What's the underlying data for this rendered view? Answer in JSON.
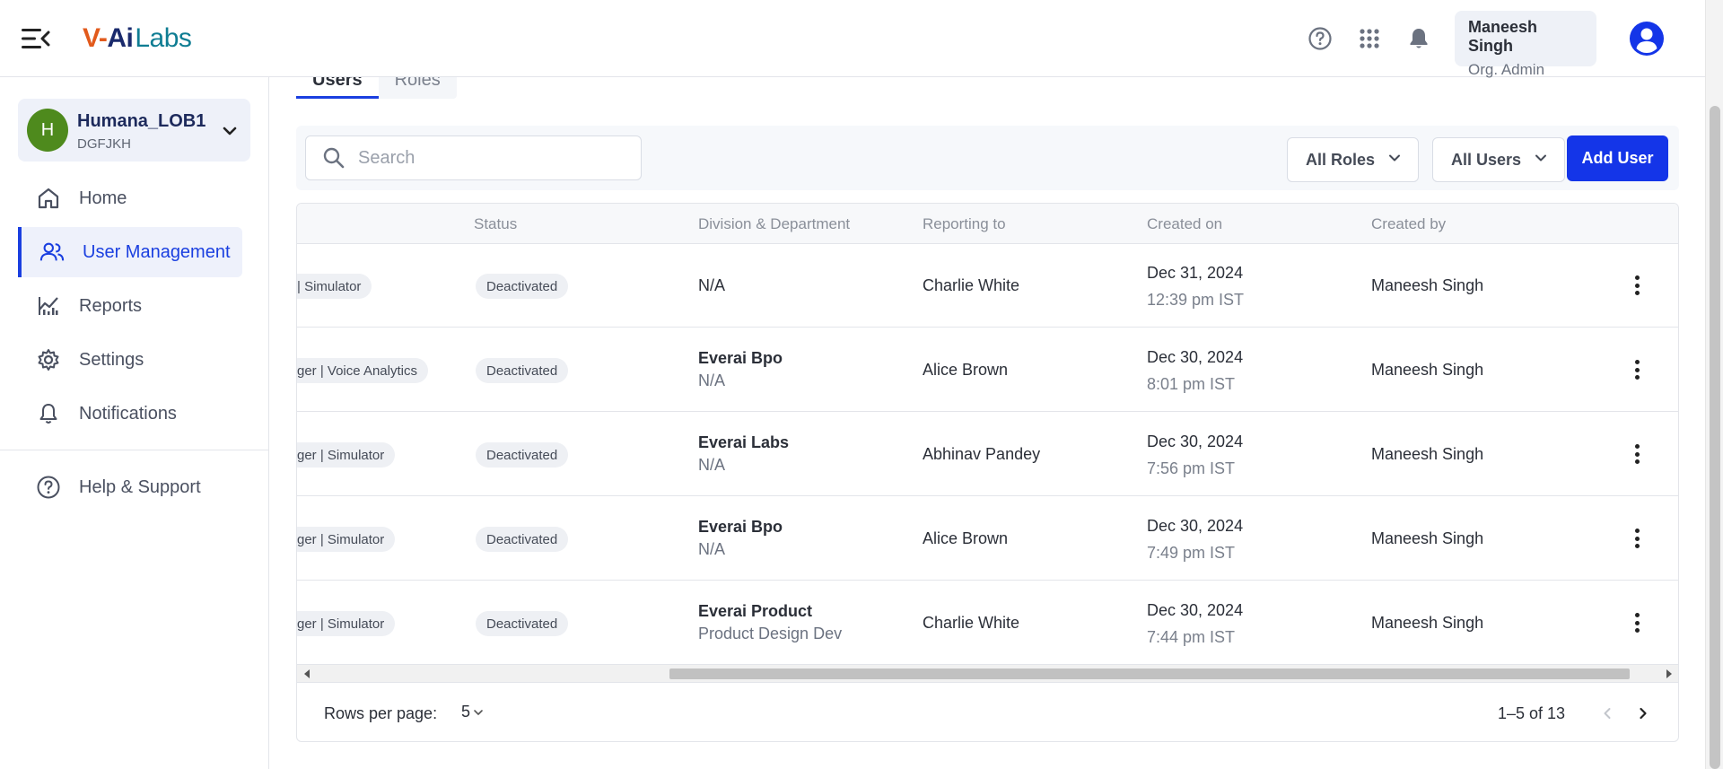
{
  "header": {
    "logo": {
      "part1": "V-",
      "part2": "Ai",
      "part3": "Labs"
    },
    "user_name": "Maneesh Singh",
    "user_role": "Org. Admin",
    "icons": [
      "menu-collapse-icon",
      "help-icon",
      "apps-grid-icon",
      "bell-icon",
      "account-circle-icon"
    ]
  },
  "sidebar": {
    "org": {
      "initial": "H",
      "name": "Humana_LOB1",
      "code": "DGFJKH"
    },
    "items": [
      {
        "label": "Home",
        "icon": "home-icon"
      },
      {
        "label": "User Management",
        "icon": "users-icon"
      },
      {
        "label": "Reports",
        "icon": "reports-icon"
      },
      {
        "label": "Settings",
        "icon": "gear-icon"
      },
      {
        "label": "Notifications",
        "icon": "bell-icon"
      }
    ],
    "help": {
      "label": "Help & Support",
      "icon": "help-icon"
    }
  },
  "tabs": [
    {
      "label": "Users"
    },
    {
      "label": "Roles"
    }
  ],
  "toolbar": {
    "search_placeholder": "Search",
    "search_value": "",
    "roles_filter": "All Roles",
    "users_filter": "All Users",
    "add_label": "Add User"
  },
  "table": {
    "columns": [
      "Status",
      "Division & Department",
      "Reporting to",
      "Created on",
      "Created by"
    ],
    "rows": [
      {
        "role": "| Simulator",
        "status": "Deactivated",
        "division": "",
        "department": "N/A",
        "reporting": "Charlie White",
        "date": "Dec 31, 2024",
        "time": "12:39 pm IST",
        "created_by": "Maneesh Singh"
      },
      {
        "role": "ger | Voice Analytics",
        "status": "Deactivated",
        "division": "Everai Bpo",
        "department": "N/A",
        "reporting": "Alice Brown",
        "date": "Dec 30, 2024",
        "time": "8:01 pm IST",
        "created_by": "Maneesh Singh"
      },
      {
        "role": "ger | Simulator",
        "status": "Deactivated",
        "division": "Everai Labs",
        "department": "N/A",
        "reporting": "Abhinav Pandey",
        "date": "Dec 30, 2024",
        "time": "7:56 pm IST",
        "created_by": "Maneesh Singh"
      },
      {
        "role": "ger | Simulator",
        "status": "Deactivated",
        "division": "Everai Bpo",
        "department": "N/A",
        "reporting": "Alice Brown",
        "date": "Dec 30, 2024",
        "time": "7:49 pm IST",
        "created_by": "Maneesh Singh"
      },
      {
        "role": "ger | Simulator",
        "status": "Deactivated",
        "division": "Everai Product",
        "department": "Product Design Dev",
        "reporting": "Charlie White",
        "date": "Dec 30, 2024",
        "time": "7:44 pm IST",
        "created_by": "Maneesh Singh"
      }
    ]
  },
  "pagination": {
    "rows_label": "Rows per page:",
    "rows_value": "5",
    "range": "1–5 of 13"
  },
  "colors": {
    "accent": "#1435e8",
    "org_avatar": "#4e8a1d",
    "active_nav": "#1a3fe0"
  }
}
